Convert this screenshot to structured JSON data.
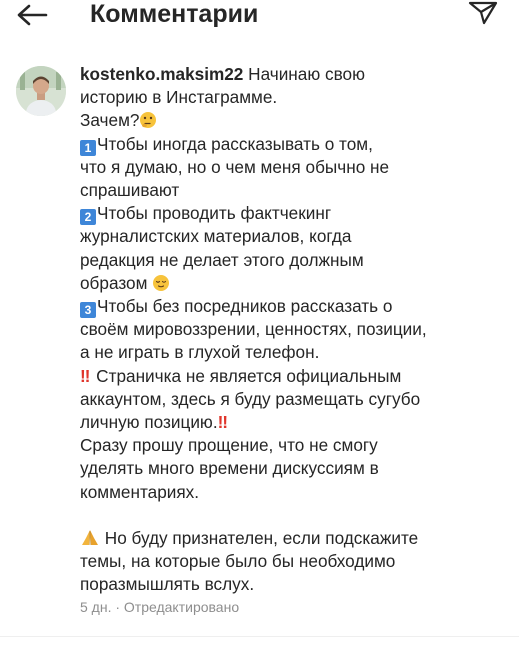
{
  "header": {
    "title": "Комментарии"
  },
  "comment": {
    "username": "kostenko.maksim22",
    "line_1": "Начинаю свою",
    "line_2": "историю в Инстаграмме.",
    "line_3": "Зачем?",
    "point_1_number": "1",
    "point_1_line_1": "Чтобы иногда рассказывать о том,",
    "point_1_line_2": "что я думаю, но о чем меня обычно не",
    "point_1_line_3": "спрашивают",
    "point_2_number": "2",
    "point_2_line_1": "Чтобы проводить фактчекинг",
    "point_2_line_2": "журналистских материалов, когда",
    "point_2_line_3": "редакция не делает этого должным",
    "point_2_line_4": "образом",
    "point_3_number": "3",
    "point_3_line_1": "Чтобы без посредников рассказать о",
    "point_3_line_2": "своём мировоззрении, ценностях, позиции,",
    "point_3_line_3": "а не играть в глухой телефон.",
    "notice_marker": "‼",
    "notice_line_1": " Страничка не является официальным",
    "notice_line_2": "аккаунтом, здесь я буду размещать сугубо",
    "notice_line_3": "личную позицию.",
    "apology_line_1": "Сразу прошу прощение, что не смогу",
    "apology_line_2": "уделять много времени дискуссиям в",
    "apology_line_3": "комментариях.",
    "closing_line_1": " Но буду признателен, если подскажите",
    "closing_line_2": "темы, на которые было бы необходимо",
    "closing_line_3": "поразмышлять вслух."
  },
  "meta": {
    "text": "5 дн. · Отредактировано"
  },
  "icons": {
    "back": "arrow-left-icon",
    "share": "paper-plane-icon",
    "thinking": "thinking-face-emoji",
    "relieved": "relieved-face-emoji",
    "pray": "folded-hands-emoji",
    "keycap": "keycap-number-emoji",
    "double_exclamation": "double-exclamation-emoji"
  },
  "colors": {
    "text": "#262626",
    "secondary_text": "#8e8e8e",
    "keycap_blue": "#3e86d8",
    "exclamation_red": "#e0352b"
  }
}
